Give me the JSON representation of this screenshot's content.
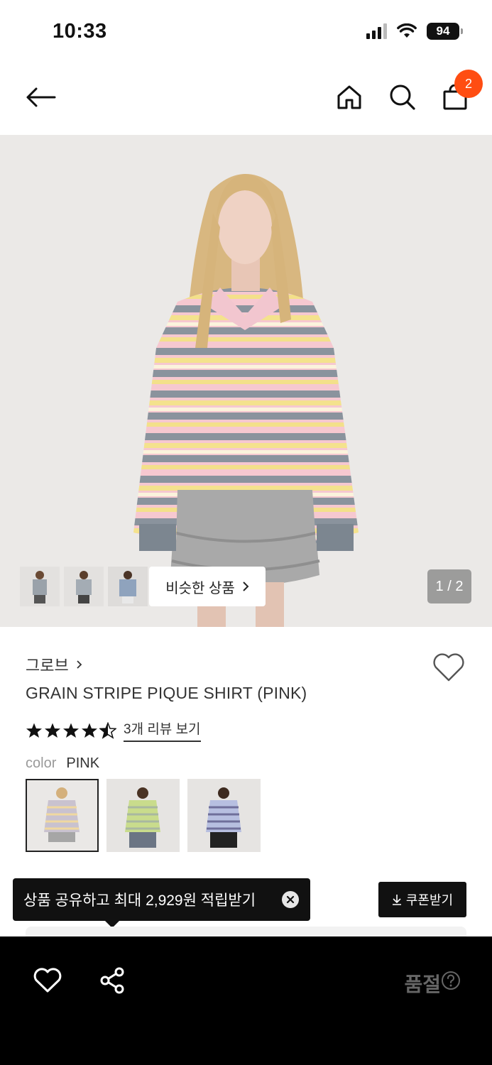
{
  "status_bar": {
    "time": "10:33",
    "battery": "94"
  },
  "nav": {
    "cart_count": "2"
  },
  "gallery": {
    "similar_label": "비슷한 상품",
    "page_indicator": "1 / 2"
  },
  "product": {
    "brand": "그로브",
    "name": "GRAIN STRIPE PIQUE SHIRT (PINK)",
    "rating": 4.5,
    "review_link": "3개 리뷰 보기",
    "color_label": "color",
    "color_value": "PINK"
  },
  "tooltip": {
    "text": "상품 공유하고 최대 2,929원 적립받기"
  },
  "coupon": {
    "label": "쿠폰받기"
  },
  "bottom": {
    "status_label": "품절"
  },
  "colors": {
    "accent": "#ff4d12",
    "dark": "#111111",
    "sold_out_text": "#666666"
  }
}
